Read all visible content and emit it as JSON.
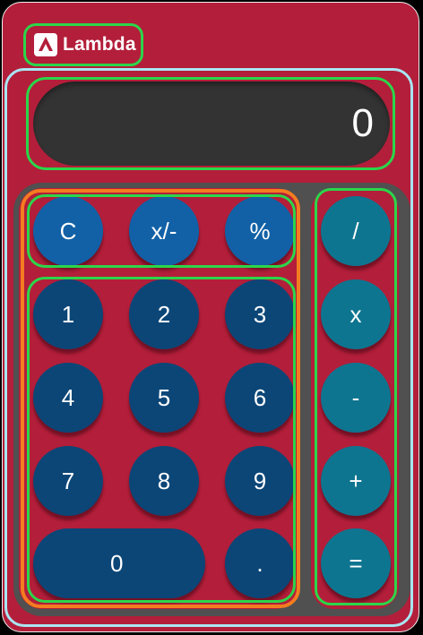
{
  "brand": {
    "name": "Lambda",
    "logo_icon": "lambda-logo-icon"
  },
  "display": {
    "value": "0"
  },
  "function_keys": [
    {
      "label": "C",
      "name": "clear-button"
    },
    {
      "label": "x/-",
      "name": "negate-button"
    },
    {
      "label": "%",
      "name": "percent-button"
    }
  ],
  "number_keys": [
    {
      "label": "1",
      "name": "digit-1-button"
    },
    {
      "label": "2",
      "name": "digit-2-button"
    },
    {
      "label": "3",
      "name": "digit-3-button"
    },
    {
      "label": "4",
      "name": "digit-4-button"
    },
    {
      "label": "5",
      "name": "digit-5-button"
    },
    {
      "label": "6",
      "name": "digit-6-button"
    },
    {
      "label": "7",
      "name": "digit-7-button"
    },
    {
      "label": "8",
      "name": "digit-8-button"
    },
    {
      "label": "9",
      "name": "digit-9-button"
    },
    {
      "label": "0",
      "name": "digit-0-button"
    },
    {
      "label": ".",
      "name": "decimal-button"
    }
  ],
  "operator_keys": [
    {
      "label": "/",
      "name": "divide-button"
    },
    {
      "label": "x",
      "name": "multiply-button"
    },
    {
      "label": "-",
      "name": "subtract-button"
    },
    {
      "label": "+",
      "name": "add-button"
    },
    {
      "label": "=",
      "name": "equals-button"
    }
  ],
  "colors": {
    "body": "#b31e3a",
    "display": "#333333",
    "keypad": "#505050",
    "function_key": "#1261a6",
    "number_key": "#0c4677",
    "operator_key": "#0e7590"
  }
}
